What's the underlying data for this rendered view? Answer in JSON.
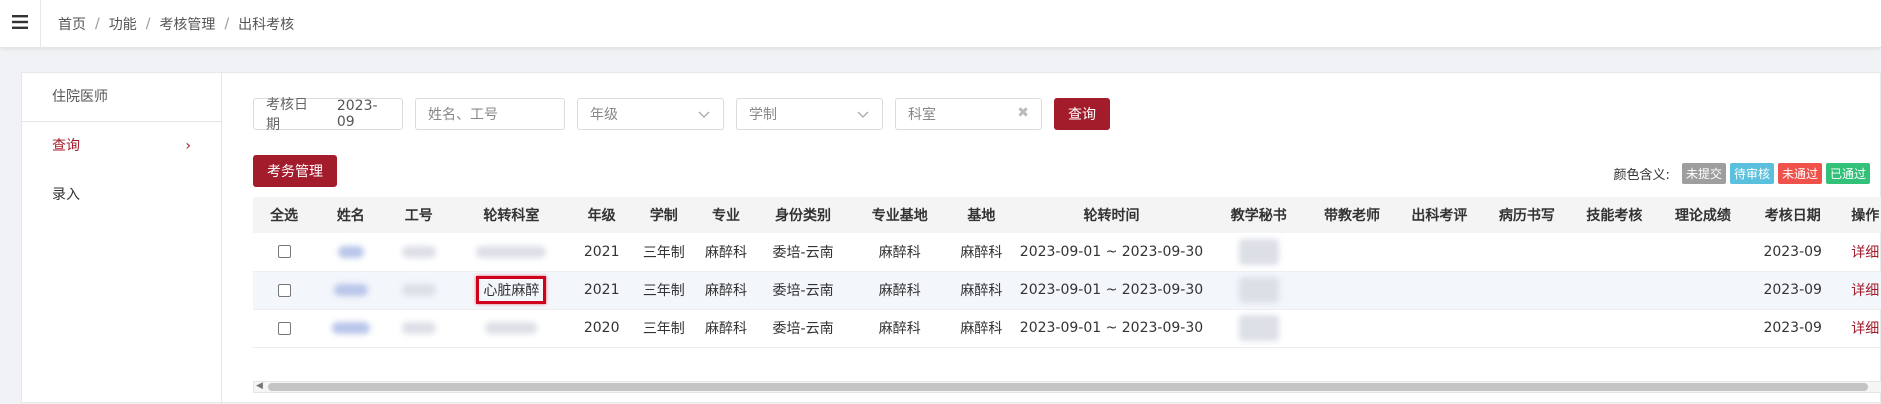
{
  "breadcrumb": [
    "首页",
    "功能",
    "考核管理",
    "出科考核"
  ],
  "sidebar": {
    "header": "住院医师",
    "items": [
      {
        "label": "查询",
        "active": true
      },
      {
        "label": "录入",
        "active": false
      }
    ]
  },
  "filters": {
    "date_label": "考核日期",
    "date_value": "2023-09",
    "name_placeholder": "姓名、工号",
    "grade_placeholder": "年级",
    "system_placeholder": "学制",
    "dept_value": "科室",
    "search_button": "查询"
  },
  "manage_button": "考务管理",
  "legend": {
    "label": "颜色含义:",
    "items": [
      {
        "text": "未提交",
        "color": "#9e9e9e"
      },
      {
        "text": "待审核",
        "color": "#5bc0de"
      },
      {
        "text": "未通过",
        "color": "#f0524b"
      },
      {
        "text": "已通过",
        "color": "#33c17a"
      }
    ]
  },
  "table": {
    "headers": [
      "全选",
      "姓名",
      "工号",
      "轮转科室",
      "年级",
      "学制",
      "专业",
      "身份类别",
      "专业基地",
      "基地",
      "轮转时间",
      "教学秘书",
      "带教老师",
      "出科考评",
      "病历书写",
      "技能考核",
      "理论成绩",
      "考核日期",
      "操作"
    ],
    "rows": [
      {
        "grade": "2021",
        "system": "三年制",
        "major": "麻醉科",
        "identity": "委培-云南",
        "base_major": "麻醉科",
        "base": "麻醉科",
        "period": "2023-09-01 ~ 2023-09-30",
        "date": "2023-09",
        "action": "详细",
        "dept": ""
      },
      {
        "grade": "2021",
        "system": "三年制",
        "major": "麻醉科",
        "identity": "委培-云南",
        "base_major": "麻醉科",
        "base": "麻醉科",
        "period": "2023-09-01 ~ 2023-09-30",
        "date": "2023-09",
        "action": "详细",
        "dept": "心脏麻醉"
      },
      {
        "grade": "2020",
        "system": "三年制",
        "major": "麻醉科",
        "identity": "委培-云南",
        "base_major": "麻醉科",
        "base": "麻醉科",
        "period": "2023-09-01 ~ 2023-09-30",
        "date": "2023-09",
        "action": "详细",
        "dept": ""
      }
    ]
  }
}
